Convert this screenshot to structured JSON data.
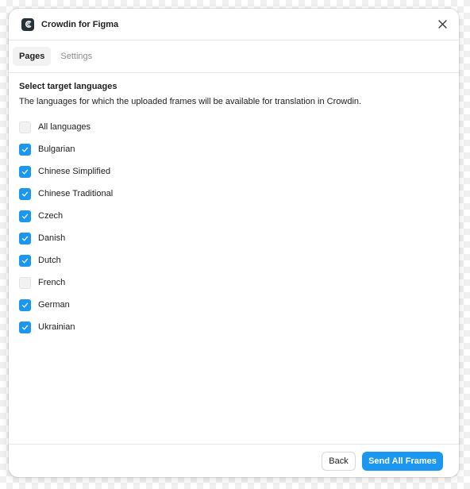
{
  "window": {
    "title": "Crowdin for Figma",
    "app_icon": "crowdin-logo-icon",
    "close_icon": "close-icon"
  },
  "tabs": [
    {
      "label": "Pages",
      "active": true
    },
    {
      "label": "Settings",
      "active": false
    }
  ],
  "main": {
    "heading": "Select target languages",
    "description": "The languages for which the uploaded frames will be available for translation in Crowdin.",
    "languages": [
      {
        "label": "All languages",
        "checked": false
      },
      {
        "label": "Bulgarian",
        "checked": true
      },
      {
        "label": "Chinese Simplified",
        "checked": true
      },
      {
        "label": "Chinese Traditional",
        "checked": true
      },
      {
        "label": "Czech",
        "checked": true
      },
      {
        "label": "Danish",
        "checked": true
      },
      {
        "label": "Dutch",
        "checked": true
      },
      {
        "label": "French",
        "checked": false
      },
      {
        "label": "German",
        "checked": true
      },
      {
        "label": "Ukrainian",
        "checked": true
      }
    ]
  },
  "footer": {
    "back_label": "Back",
    "send_label": "Send All Frames"
  },
  "colors": {
    "accent": "#1b97ef",
    "text": "#1e1e1e",
    "muted": "#8c8c8c",
    "border": "#e6e6e6"
  }
}
